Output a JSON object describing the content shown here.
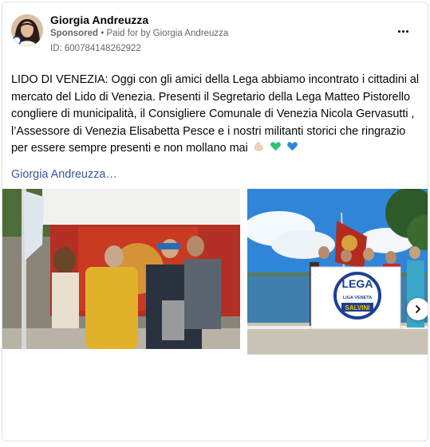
{
  "post": {
    "author": "Giorgia Andreuzza",
    "sponsored_label": "Sponsored",
    "separator": "•",
    "paid_for": "Paid for by Giorgia Andreuzza",
    "ad_id": "ID: 600784148262922",
    "text": "LIDO DI VENEZIA: Oggi con gli amici della Lega abbiamo incontrato i cittadini al mercato del Lido di Venezia. Presenti il Segretario della Lega Matteo Pistorello congliere di municipalità, il Consigliere Comunale di Venezia Nicola Gervasutti , l’Assessore di Venezia Elisabetta Pesce e i nostri militanti storici che ringrazio per essere sempre presenti e non mollano mai",
    "emojis": [
      {
        "icon": "flexed-biceps-icon",
        "color": "#f2d4bd"
      },
      {
        "icon": "green-heart-icon",
        "color": "#2cc46e"
      },
      {
        "icon": "blue-heart-icon",
        "color": "#2f86d6"
      }
    ],
    "see_more": "Giorgia Andreuzza…"
  },
  "banner": {
    "lega": "LEGA",
    "liga_veneta": "LIGA VENETA",
    "salvini": "SALVINI"
  },
  "colors": {
    "text": "#050505",
    "secondary": "#65676b",
    "link": "#385898",
    "lega_blue": "#1d3f94",
    "lega_yellow": "#f5c400"
  }
}
